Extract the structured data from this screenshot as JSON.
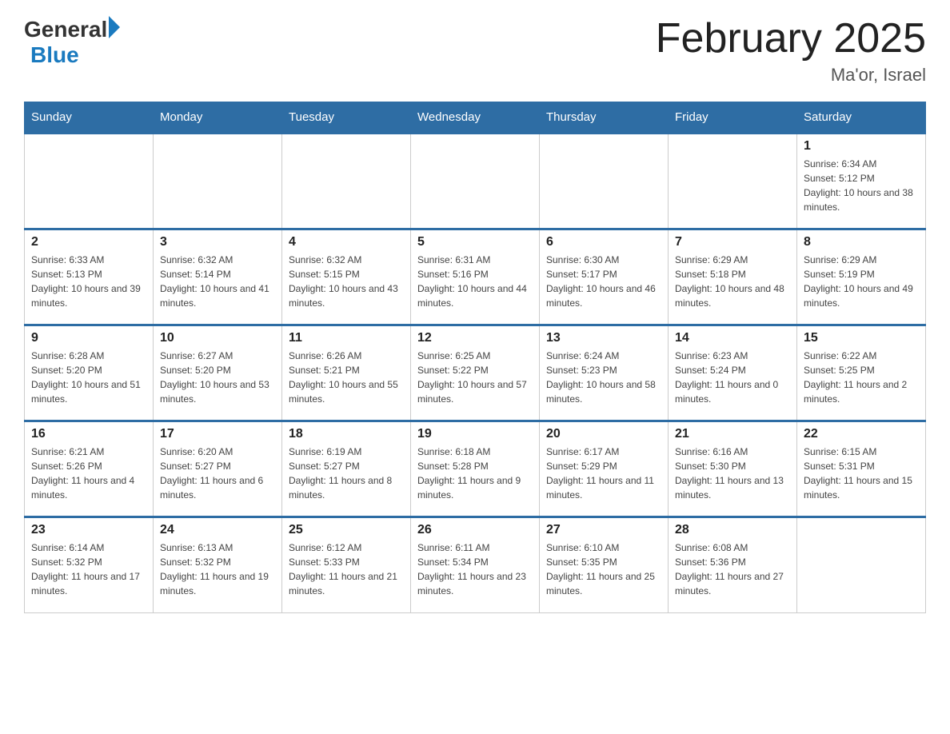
{
  "header": {
    "logo_general": "General",
    "logo_blue": "Blue",
    "title": "February 2025",
    "location": "Ma'or, Israel"
  },
  "days_of_week": [
    "Sunday",
    "Monday",
    "Tuesday",
    "Wednesday",
    "Thursday",
    "Friday",
    "Saturday"
  ],
  "weeks": [
    [
      {
        "day": "",
        "info": ""
      },
      {
        "day": "",
        "info": ""
      },
      {
        "day": "",
        "info": ""
      },
      {
        "day": "",
        "info": ""
      },
      {
        "day": "",
        "info": ""
      },
      {
        "day": "",
        "info": ""
      },
      {
        "day": "1",
        "info": "Sunrise: 6:34 AM\nSunset: 5:12 PM\nDaylight: 10 hours and 38 minutes."
      }
    ],
    [
      {
        "day": "2",
        "info": "Sunrise: 6:33 AM\nSunset: 5:13 PM\nDaylight: 10 hours and 39 minutes."
      },
      {
        "day": "3",
        "info": "Sunrise: 6:32 AM\nSunset: 5:14 PM\nDaylight: 10 hours and 41 minutes."
      },
      {
        "day": "4",
        "info": "Sunrise: 6:32 AM\nSunset: 5:15 PM\nDaylight: 10 hours and 43 minutes."
      },
      {
        "day": "5",
        "info": "Sunrise: 6:31 AM\nSunset: 5:16 PM\nDaylight: 10 hours and 44 minutes."
      },
      {
        "day": "6",
        "info": "Sunrise: 6:30 AM\nSunset: 5:17 PM\nDaylight: 10 hours and 46 minutes."
      },
      {
        "day": "7",
        "info": "Sunrise: 6:29 AM\nSunset: 5:18 PM\nDaylight: 10 hours and 48 minutes."
      },
      {
        "day": "8",
        "info": "Sunrise: 6:29 AM\nSunset: 5:19 PM\nDaylight: 10 hours and 49 minutes."
      }
    ],
    [
      {
        "day": "9",
        "info": "Sunrise: 6:28 AM\nSunset: 5:20 PM\nDaylight: 10 hours and 51 minutes."
      },
      {
        "day": "10",
        "info": "Sunrise: 6:27 AM\nSunset: 5:20 PM\nDaylight: 10 hours and 53 minutes."
      },
      {
        "day": "11",
        "info": "Sunrise: 6:26 AM\nSunset: 5:21 PM\nDaylight: 10 hours and 55 minutes."
      },
      {
        "day": "12",
        "info": "Sunrise: 6:25 AM\nSunset: 5:22 PM\nDaylight: 10 hours and 57 minutes."
      },
      {
        "day": "13",
        "info": "Sunrise: 6:24 AM\nSunset: 5:23 PM\nDaylight: 10 hours and 58 minutes."
      },
      {
        "day": "14",
        "info": "Sunrise: 6:23 AM\nSunset: 5:24 PM\nDaylight: 11 hours and 0 minutes."
      },
      {
        "day": "15",
        "info": "Sunrise: 6:22 AM\nSunset: 5:25 PM\nDaylight: 11 hours and 2 minutes."
      }
    ],
    [
      {
        "day": "16",
        "info": "Sunrise: 6:21 AM\nSunset: 5:26 PM\nDaylight: 11 hours and 4 minutes."
      },
      {
        "day": "17",
        "info": "Sunrise: 6:20 AM\nSunset: 5:27 PM\nDaylight: 11 hours and 6 minutes."
      },
      {
        "day": "18",
        "info": "Sunrise: 6:19 AM\nSunset: 5:27 PM\nDaylight: 11 hours and 8 minutes."
      },
      {
        "day": "19",
        "info": "Sunrise: 6:18 AM\nSunset: 5:28 PM\nDaylight: 11 hours and 9 minutes."
      },
      {
        "day": "20",
        "info": "Sunrise: 6:17 AM\nSunset: 5:29 PM\nDaylight: 11 hours and 11 minutes."
      },
      {
        "day": "21",
        "info": "Sunrise: 6:16 AM\nSunset: 5:30 PM\nDaylight: 11 hours and 13 minutes."
      },
      {
        "day": "22",
        "info": "Sunrise: 6:15 AM\nSunset: 5:31 PM\nDaylight: 11 hours and 15 minutes."
      }
    ],
    [
      {
        "day": "23",
        "info": "Sunrise: 6:14 AM\nSunset: 5:32 PM\nDaylight: 11 hours and 17 minutes."
      },
      {
        "day": "24",
        "info": "Sunrise: 6:13 AM\nSunset: 5:32 PM\nDaylight: 11 hours and 19 minutes."
      },
      {
        "day": "25",
        "info": "Sunrise: 6:12 AM\nSunset: 5:33 PM\nDaylight: 11 hours and 21 minutes."
      },
      {
        "day": "26",
        "info": "Sunrise: 6:11 AM\nSunset: 5:34 PM\nDaylight: 11 hours and 23 minutes."
      },
      {
        "day": "27",
        "info": "Sunrise: 6:10 AM\nSunset: 5:35 PM\nDaylight: 11 hours and 25 minutes."
      },
      {
        "day": "28",
        "info": "Sunrise: 6:08 AM\nSunset: 5:36 PM\nDaylight: 11 hours and 27 minutes."
      },
      {
        "day": "",
        "info": ""
      }
    ]
  ]
}
